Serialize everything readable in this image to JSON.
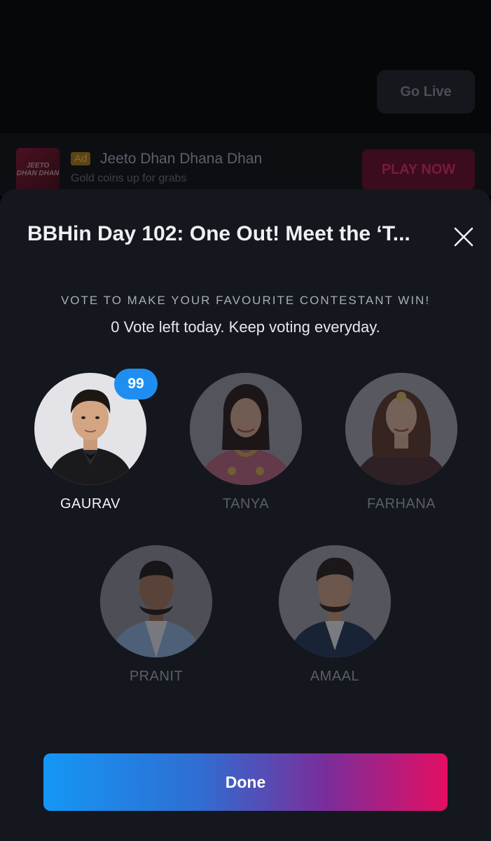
{
  "background": {
    "go_live_label": "Go Live",
    "ad": {
      "thumb_text": "JEETO DHAN DHAN",
      "tag": "Ad",
      "title": "Jeeto Dhan Dhana Dhan",
      "subtitle": "Gold coins up for grabs",
      "cta": "PLAY NOW"
    }
  },
  "sheet": {
    "title": "BBHin Day 102: One Out! Meet the ‘T...",
    "caption": "VOTE TO MAKE YOUR FAVOURITE CONTESTANT WIN!",
    "votes_left": "0 Vote left today. Keep voting everyday.",
    "contestants": [
      {
        "name": "GAURAV",
        "votes": "99",
        "selected": true
      },
      {
        "name": "TANYA",
        "selected": false
      },
      {
        "name": "FARHANA",
        "selected": false
      },
      {
        "name": "PRANIT",
        "selected": false
      },
      {
        "name": "AMAAL",
        "selected": false
      }
    ],
    "done_label": "Done"
  },
  "colors": {
    "sheet_bg": "#15171e",
    "badge_blue": "#1e8ff0",
    "done_gradient_start": "#1497f5",
    "done_gradient_end": "#e50e63"
  }
}
